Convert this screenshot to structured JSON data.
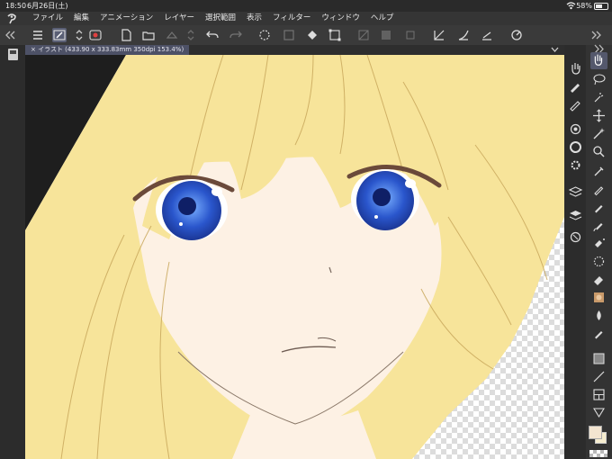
{
  "status_bar": {
    "time": "18:50",
    "date": "6月26日(土)",
    "battery": "58%"
  },
  "menu": {
    "items": [
      "ファイル",
      "編集",
      "アニメーション",
      "レイヤー",
      "選択範囲",
      "表示",
      "フィルター",
      "ウィンドウ",
      "ヘルプ"
    ]
  },
  "canvas_tab": {
    "label": "× イラスト (433.90 x 333.83mm 350dpi 153.4%)"
  },
  "colors": {
    "accent": "#5a5f75",
    "hair": "#f7e49a",
    "skin": "#fdf1e4",
    "iris": "#2f5fc8",
    "main_color": "#f3e5d0",
    "sub_color": "#f6edcf"
  }
}
